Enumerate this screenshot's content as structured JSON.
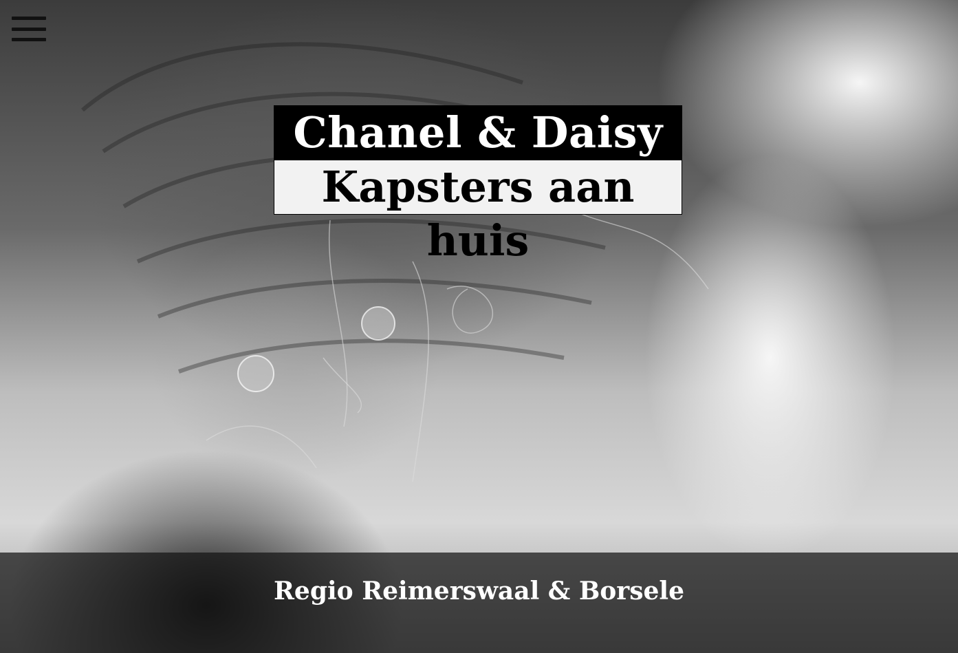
{
  "header": {
    "menu_icon": "hamburger-menu-icon"
  },
  "hero": {
    "title_line1": "Chanel & Daisy",
    "title_line2": "Kapsters aan huis",
    "background_image": "black-and-white photo of braided updo hairstyle with crystal hairpins"
  },
  "footer": {
    "region": "Regio Reimerswaal & Borsele"
  },
  "colors": {
    "title_bg_dark": "#000000",
    "title_bg_light": "#f2f2f2",
    "footer_overlay": "#141414"
  }
}
